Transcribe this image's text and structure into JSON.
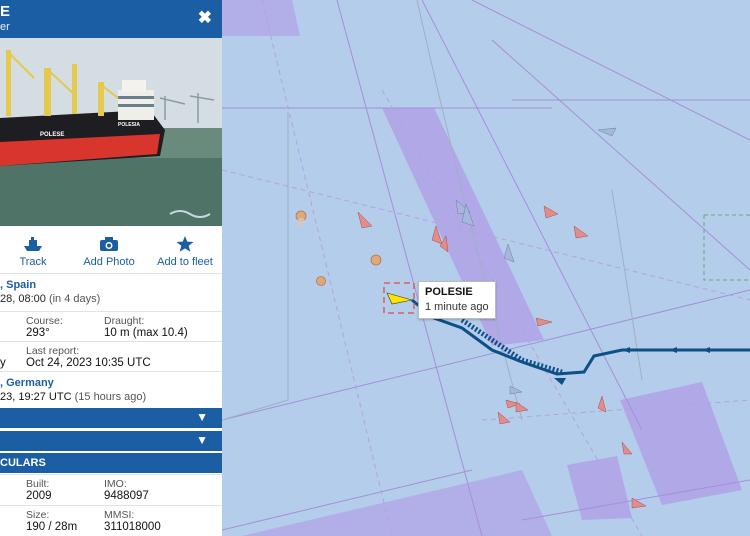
{
  "vessel": {
    "name_partial": "E",
    "type_partial": "er",
    "close_label": "✖"
  },
  "actions": [
    {
      "label": "Track",
      "icon": "ship-icon"
    },
    {
      "label": "Add Photo",
      "icon": "camera-icon"
    },
    {
      "label": "Add to fleet",
      "icon": "star-icon"
    }
  ],
  "departure": {
    "port": ", Spain",
    "eta": "28, 08:00",
    "eta_rel": "(in 4 days)"
  },
  "course": {
    "label": "Course:",
    "value": "293°"
  },
  "draught": {
    "label": "Draught:",
    "value": "10 m (max 10.4)"
  },
  "last_report": {
    "label": "Last report:",
    "value": "Oct 24, 2023 10:35 UTC",
    "left_partial": "y"
  },
  "origin": {
    "port": ", Germany",
    "time": "23, 19:27 UTC",
    "time_rel": "(15 hours ago)"
  },
  "section_bars": [
    {
      "label": "",
      "chevron": "▼"
    },
    {
      "label": "",
      "chevron": "▼"
    }
  ],
  "particulars": {
    "title": "CULARS"
  },
  "built": {
    "label": "Built:",
    "value": "2009"
  },
  "imo": {
    "label": "IMO:",
    "value": "9488097"
  },
  "size": {
    "label": "Size:",
    "value": "190 / 28m"
  },
  "mmsi": {
    "label": "MMSI:",
    "value": "311018000"
  },
  "map_tooltip": {
    "title": "POLESIE",
    "subtitle": "1 minute ago"
  },
  "photo_text": {
    "bow_name": "POLESE",
    "hull_name": "POLESIA"
  },
  "colors": {
    "brand": "#1b5ea3",
    "sea": "#b4cdea",
    "lane": "#b09be6",
    "track": "#0d4f86"
  }
}
